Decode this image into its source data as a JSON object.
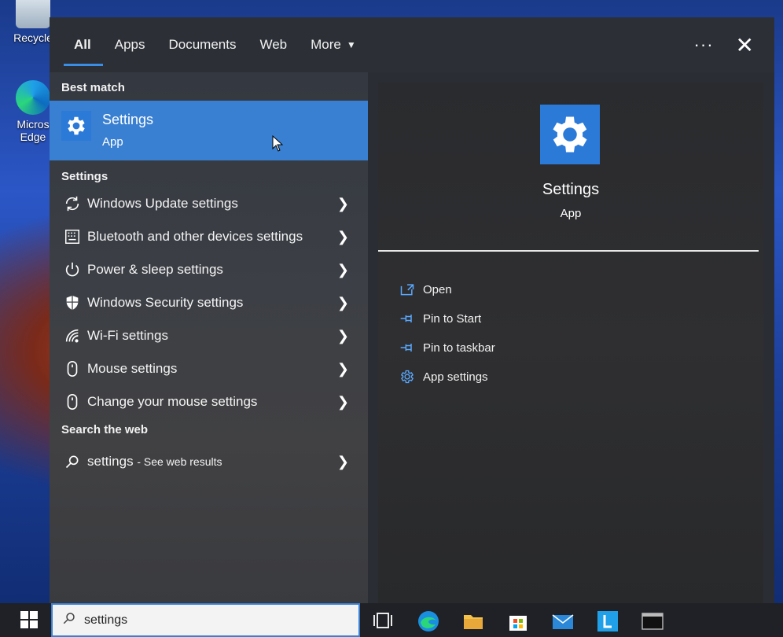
{
  "desktop": {
    "recycle_label": "Recycle",
    "edge_label_1": "Micros",
    "edge_label_2": "Edge"
  },
  "tabs": [
    {
      "label": "All"
    },
    {
      "label": "Apps"
    },
    {
      "label": "Documents"
    },
    {
      "label": "Web"
    },
    {
      "label": "More"
    }
  ],
  "best_match": {
    "heading": "Best match",
    "title": "Settings",
    "subtitle": "App",
    "icon": "gear-icon"
  },
  "settings_section": {
    "heading": "Settings",
    "items": [
      {
        "label": "Windows Update settings",
        "icon": "refresh-icon"
      },
      {
        "label": "Bluetooth and other devices settings",
        "icon": "keyboard-device-icon"
      },
      {
        "label": "Power & sleep settings",
        "icon": "power-icon"
      },
      {
        "label": "Windows Security settings",
        "icon": "shield-icon"
      },
      {
        "label": "Wi-Fi settings",
        "icon": "wifi-icon"
      },
      {
        "label": "Mouse settings",
        "icon": "mouse-icon"
      },
      {
        "label": "Change your mouse settings",
        "icon": "mouse-icon"
      }
    ]
  },
  "web_section": {
    "heading": "Search the web",
    "query": "settings",
    "suffix": "- See web results",
    "icon": "search-icon"
  },
  "detail": {
    "title": "Settings",
    "subtitle": "App",
    "actions": [
      {
        "label": "Open",
        "icon": "open-icon"
      },
      {
        "label": "Pin to Start",
        "icon": "pin-icon"
      },
      {
        "label": "Pin to taskbar",
        "icon": "pin-icon"
      },
      {
        "label": "App settings",
        "icon": "gear-icon"
      }
    ]
  },
  "search_box": {
    "value": "settings"
  },
  "colors": {
    "accent": "#3a80d2",
    "panel": "#2a2d33",
    "taskbar": "#1f2126"
  }
}
